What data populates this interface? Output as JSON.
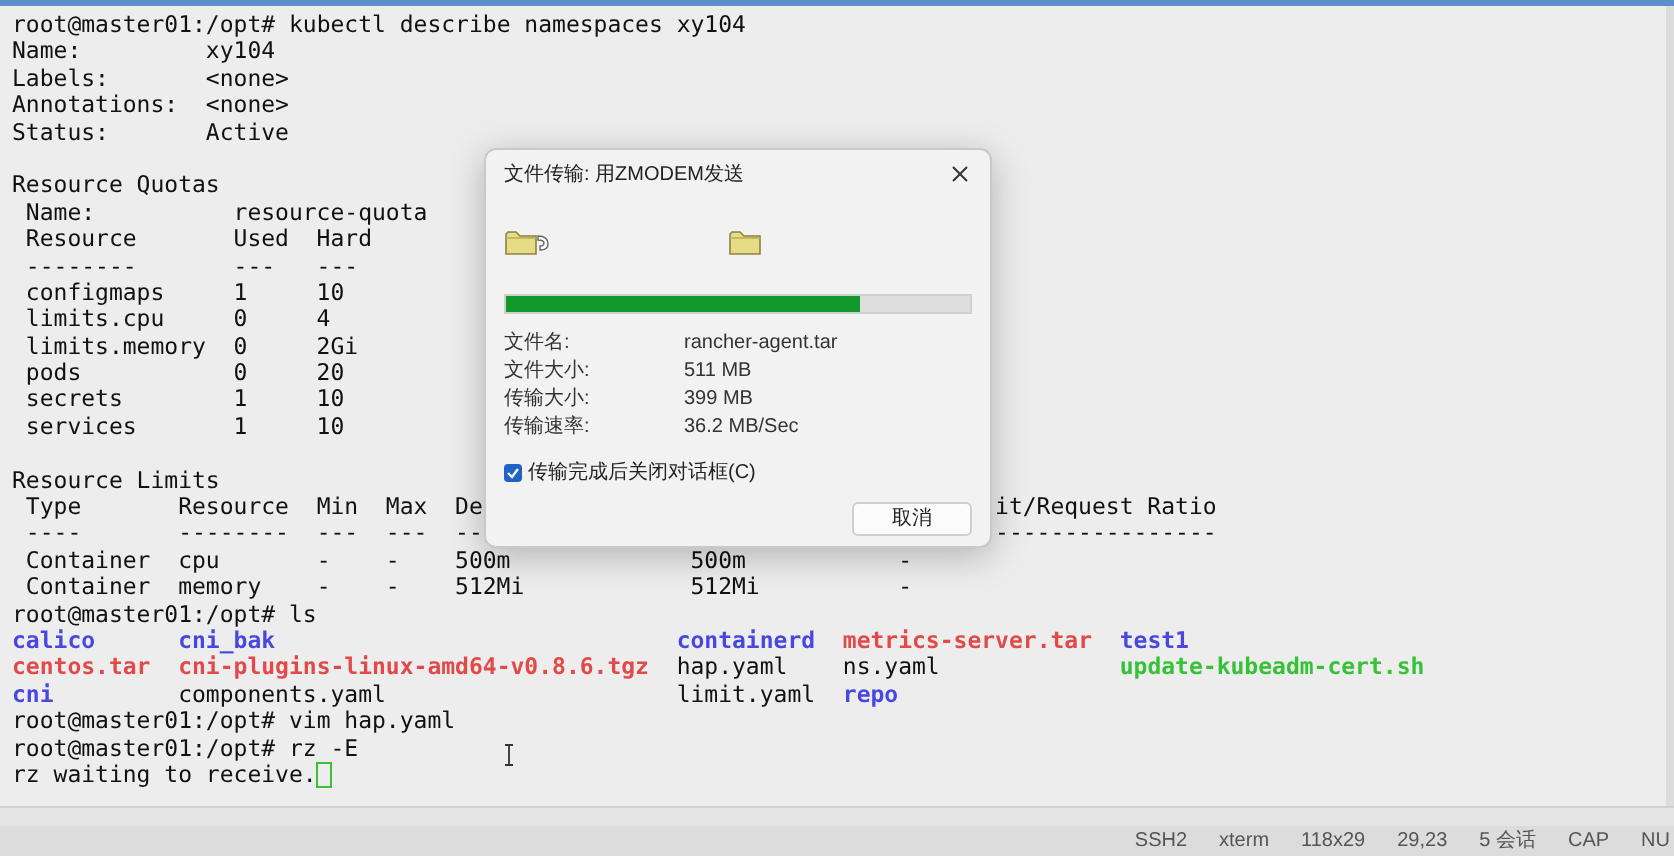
{
  "terminal": {
    "lines": [
      {
        "kind": "prompt",
        "text": "root@master01:/opt# kubectl describe namespaces xy104"
      },
      {
        "kind": "field",
        "label": "Name:",
        "value": "xy104"
      },
      {
        "kind": "field",
        "label": "Labels:",
        "value": "<none>"
      },
      {
        "kind": "field",
        "label": "Annotations:",
        "value": "<none>"
      },
      {
        "kind": "field",
        "label": "Status:",
        "value": "Active"
      },
      {
        "kind": "blank"
      },
      {
        "kind": "heading",
        "text": "Resource Quotas"
      },
      {
        "kind": "quota",
        "name_label": "Name:",
        "name": "resource-quota",
        "columns": [
          {
            "header": "Resource",
            "rule": "--------"
          },
          {
            "header": "Used",
            "rule": "---"
          },
          {
            "header": "Hard",
            "rule": "---"
          }
        ],
        "rows": [
          [
            "configmaps",
            "1",
            "10"
          ],
          [
            "limits.cpu",
            "0",
            "4"
          ],
          [
            "limits.memory",
            "0",
            "2Gi"
          ],
          [
            "pods",
            "0",
            "20"
          ],
          [
            "secrets",
            "1",
            "10"
          ],
          [
            "services",
            "1",
            "10"
          ]
        ]
      },
      {
        "kind": "blank"
      },
      {
        "kind": "heading",
        "text": "Resource Limits"
      },
      {
        "kind": "limits",
        "columns": [
          {
            "header": "Type",
            "rule": "----"
          },
          {
            "header": "Resource",
            "rule": "--------"
          },
          {
            "header": "Min",
            "rule": "---"
          },
          {
            "header": "Max",
            "rule": "---"
          },
          {
            "header": "De",
            "rule": "--"
          },
          {},
          {
            "header": "it/Request Ratio",
            "rule": "----------------"
          }
        ],
        "rows": [
          [
            "Container",
            "cpu",
            "-",
            "-",
            "500m",
            "500m",
            "-"
          ],
          [
            "Container",
            "memory",
            "-",
            "-",
            "512Mi",
            "512Mi",
            "-"
          ]
        ]
      },
      {
        "kind": "prompt",
        "text": "root@master01:/opt# ls"
      },
      {
        "kind": "ls",
        "rows": [
          [
            {
              "name": "calico",
              "kind": "dir"
            },
            {
              "name": "cni_bak",
              "kind": "dir"
            },
            {
              "name": "containerd",
              "kind": "dir"
            },
            {
              "name": "metrics-server.tar",
              "kind": "archive"
            },
            {
              "name": "test1",
              "kind": "dir"
            }
          ],
          [
            {
              "name": "centos.tar",
              "kind": "archive"
            },
            {
              "name": "cni-plugins-linux-amd64-v0.8.6.tgz",
              "kind": "archive"
            },
            {
              "name": "hap.yaml",
              "kind": "file"
            },
            {
              "name": "ns.yaml",
              "kind": "file"
            },
            {
              "name": "update-kubeadm-cert.sh",
              "kind": "exec"
            }
          ],
          [
            {
              "name": "cni",
              "kind": "dir"
            },
            {
              "name": "components.yaml",
              "kind": "file"
            },
            {
              "name": "limit.yaml",
              "kind": "file"
            },
            {
              "name": "repo",
              "kind": "dir"
            }
          ]
        ]
      },
      {
        "kind": "prompt",
        "text": "root@master01:/opt# vim hap.yaml"
      },
      {
        "kind": "prompt",
        "text": "root@master01:/opt# rz -E"
      },
      {
        "kind": "output",
        "text": "rz waiting to receive.",
        "cursor": true
      }
    ]
  },
  "dialog": {
    "title": "文件传输: 用ZMODEM发送",
    "level": 0.765,
    "fields": [
      {
        "label": "文件名:",
        "value": "rancher-agent.tar"
      },
      {
        "label": "文件大小:",
        "value": "511 MB"
      },
      {
        "label": "传输大小:",
        "value": "399 MB"
      },
      {
        "label": "传输速率:",
        "value": "36.2 MB/Sec"
      }
    ],
    "checkbox": {
      "label": "传输完成后关闭对话框(C)",
      "checked": true
    },
    "button": "取消"
  },
  "status_bar": [
    "SSH2",
    "xterm",
    "118x29",
    "29,23",
    "5 会话",
    "CAP",
    "NU"
  ]
}
